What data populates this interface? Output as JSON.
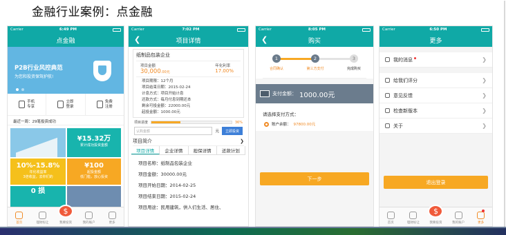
{
  "page": {
    "title": "金融行业案例：点金融"
  },
  "colors": {
    "teal": "#10a9a6",
    "orange": "#f7a823",
    "highlight": "#f08a24",
    "blue": "#3d7fd8"
  },
  "status": {
    "carrier": "Carrier"
  },
  "phone1": {
    "time": "6:49 PM",
    "nav_title": "点金融",
    "banner_title": "P2B行业风控典范",
    "banner_sub": "为您和投资保驾护航!",
    "quick": [
      {
        "line1": "手机",
        "line2": "专享"
      },
      {
        "line1": "立即",
        "line2": "登录"
      },
      {
        "line1": "免费",
        "line2": "注册"
      }
    ],
    "notice": "最近一周：29笔投资成功",
    "tile_b_value": "¥15.32万",
    "tile_b_caption": "累计成功投资金额",
    "tile_c_value": "10%-15.8%",
    "tile_c_caption1": "年化收益率",
    "tile_c_caption2": "3倍收益，去你们的",
    "tile_d_value": "¥100",
    "tile_d_caption1": "起投金额",
    "tile_d_caption2": "低门槛，放心投资",
    "tile_e_value": "0 损",
    "tabs": [
      "首页",
      "理财标让",
      "我要投资",
      "我的账户",
      "更多"
    ]
  },
  "phone2": {
    "time": "7:02 PM",
    "nav_title": "项目详情",
    "product": "纸制品包装企业",
    "amount_label": "项目金额",
    "amount_value": "30,000",
    "amount_unit": ".00元",
    "rate_label": "年化利率",
    "rate_value": "17.00%",
    "info": [
      "项目期限：12个月",
      "项目结束日期：2015-02-24",
      "计息方式：项目开始计息",
      "还款方式：每月付息到期还本",
      "剩余可投金额：22000.00元",
      "起投金额：1000.00元"
    ],
    "progress_label": "项目进度",
    "progress_value": 36,
    "progress_text": "36%",
    "amount_placeholder": "认购金额",
    "yuan": "元",
    "invest_button": "立即投资",
    "intro_label": "项目简介",
    "tabs": [
      "项目详情",
      "企业详情",
      "担保详情",
      "还款计划"
    ],
    "details": [
      "项目名称：纸制品包装企业",
      "项目金额：30000.00元",
      "项目开始日期：2014-02-25",
      "项目结束日期：2015-02-24",
      "项目用途：民用建筑，供人们生活、居住、"
    ]
  },
  "phone3": {
    "time": "8:05 PM",
    "nav_title": "购买",
    "steps": [
      {
        "num": "1",
        "label": "合同确认"
      },
      {
        "num": "2",
        "label": "第三方支付"
      },
      {
        "num": "3",
        "label": "完成购买"
      }
    ],
    "pay_label": "支付金额：",
    "pay_amount": "1000.00元",
    "method_label": "请选择支付方式：",
    "balance_label": "账户余额：",
    "balance_value": "97800.00元",
    "next_button": "下一步"
  },
  "phone4": {
    "time": "6:50 PM",
    "nav_title": "更多",
    "menu": [
      "我的消息",
      "给我们评分",
      "意见反馈",
      "检查新版本",
      "关于"
    ],
    "logout_button": "退出登录",
    "tabs": [
      "首页",
      "理财标让",
      "我要投资",
      "我的账户",
      "更多"
    ]
  }
}
